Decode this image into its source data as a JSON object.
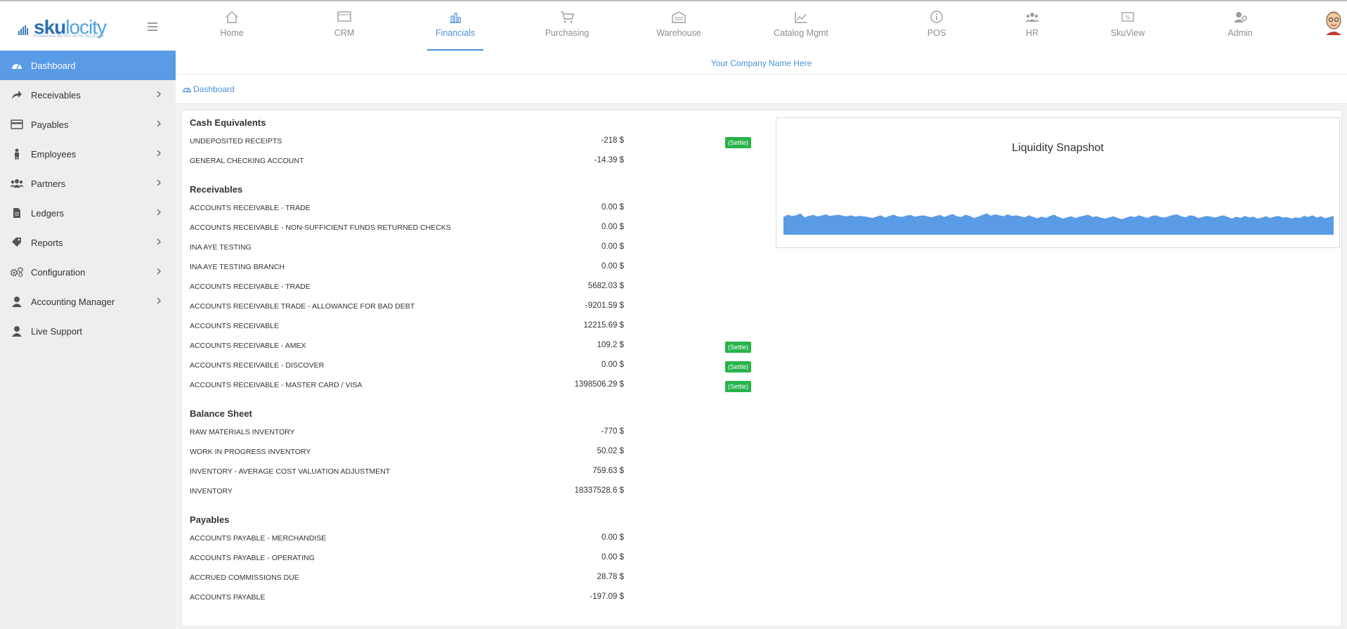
{
  "app": {
    "logo_text_main": "sku",
    "logo_text_accent": "locity",
    "logo_tagline": "POWERING RETAIL WITH VELOCITY"
  },
  "topnav": [
    {
      "label": "Home",
      "icon": "home-icon"
    },
    {
      "label": "CRM",
      "icon": "crm-icon"
    },
    {
      "label": "Financials",
      "icon": "bar-chart-icon",
      "active": true
    },
    {
      "label": "Purchasing",
      "icon": "cart-icon"
    },
    {
      "label": "Warehouse",
      "icon": "warehouse-icon"
    },
    {
      "label": "Catalog Mgmt",
      "icon": "line-chart-icon"
    },
    {
      "label": "POS",
      "icon": "info-icon"
    },
    {
      "label": "HR",
      "icon": "users-icon"
    },
    {
      "label": "SkuView",
      "icon": "money-icon"
    },
    {
      "label": "Admin",
      "icon": "admin-icon"
    }
  ],
  "sidebar": {
    "items": [
      {
        "label": "Dashboard",
        "icon": "dashboard-icon",
        "active": true,
        "has_children": false
      },
      {
        "label": "Receivables",
        "icon": "share-icon",
        "has_children": true
      },
      {
        "label": "Payables",
        "icon": "credit-card-icon",
        "has_children": true
      },
      {
        "label": "Employees",
        "icon": "person-icon",
        "has_children": true
      },
      {
        "label": "Partners",
        "icon": "group-icon",
        "has_children": true
      },
      {
        "label": "Ledgers",
        "icon": "document-icon",
        "has_children": true
      },
      {
        "label": "Reports",
        "icon": "tag-icon",
        "has_children": true
      },
      {
        "label": "Configuration",
        "icon": "gears-icon",
        "has_children": true
      },
      {
        "label": "Accounting Manager",
        "icon": "user-icon",
        "has_children": true
      },
      {
        "label": "Live Support",
        "icon": "user-icon",
        "has_children": false
      }
    ]
  },
  "company_name": "Your Company Name Here",
  "breadcrumb": "Dashboard",
  "settle_label": "(Settle)",
  "sections": [
    {
      "title": "Cash Equivalents",
      "rows": [
        {
          "label": "UNDEPOSITED RECEIPTS",
          "value": "-218 $",
          "settle": true
        },
        {
          "label": "GENERAL CHECKING ACCOUNT",
          "value": "-14.39 $",
          "settle": false
        }
      ]
    },
    {
      "title": "Receivables",
      "rows": [
        {
          "label": "ACCOUNTS RECEIVABLE - TRADE",
          "value": "0.00 $",
          "settle": false
        },
        {
          "label": "ACCOUNTS RECEIVABLE - NON-SUFFICIENT FUNDS RETURNED CHECKS",
          "value": "0.00 $",
          "settle": false
        },
        {
          "label": "INA AYE TESTING",
          "value": "0.00 $",
          "settle": false
        },
        {
          "label": "INA AYE TESTING BRANCH",
          "value": "0.00 $",
          "settle": false
        },
        {
          "label": "ACCOUNTS RECEIVABLE - TRADE",
          "value": "5682.03 $",
          "settle": false
        },
        {
          "label": "ACCOUNTS RECEIVABLE TRADE - ALLOWANCE FOR BAD DEBT",
          "value": "-9201.59 $",
          "settle": false
        },
        {
          "label": "ACCOUNTS RECEIVABLE",
          "value": "12215.69 $",
          "settle": false
        },
        {
          "label": "ACCOUNTS RECEIVABLE - AMEX",
          "value": "109.2 $",
          "settle": true
        },
        {
          "label": "ACCOUNTS RECEIVABLE - DISCOVER",
          "value": "0.00 $",
          "settle": true
        },
        {
          "label": "ACCOUNTS RECEIVABLE - MASTER CARD / VISA",
          "value": "1398506.29 $",
          "settle": true
        }
      ]
    },
    {
      "title": "Balance Sheet",
      "rows": [
        {
          "label": "RAW MATERIALS INVENTORY",
          "value": "-770 $",
          "settle": false
        },
        {
          "label": "WORK IN PROGRESS INVENTORY",
          "value": "50.02 $",
          "settle": false
        },
        {
          "label": "INVENTORY - AVERAGE COST VALUATION ADJUSTMENT",
          "value": "759.63 $",
          "settle": false
        },
        {
          "label": "INVENTORY",
          "value": "18337528.6 $",
          "settle": false
        }
      ]
    },
    {
      "title": "Payables",
      "rows": [
        {
          "label": "ACCOUNTS PAYABLE - MERCHANDISE",
          "value": "0.00 $",
          "settle": false
        },
        {
          "label": "ACCOUNTS PAYABLE - OPERATING",
          "value": "0.00 $",
          "settle": false
        },
        {
          "label": "ACCRUED COMMISSIONS DUE",
          "value": "28.78 $",
          "settle": false
        },
        {
          "label": "ACCOUNTS PAYABLE",
          "value": "-197.09 $",
          "settle": false
        }
      ]
    }
  ],
  "chart_data": {
    "type": "area",
    "title": "Liquidity Snapshot",
    "color": "#5a9be6",
    "ylim": [
      0,
      100
    ],
    "values": [
      55,
      62,
      58,
      60,
      66,
      54,
      58,
      61,
      57,
      59,
      63,
      58,
      60,
      62,
      59,
      57,
      60,
      56,
      58,
      57,
      55,
      52,
      56,
      60,
      53,
      58,
      62,
      57,
      55,
      59,
      61,
      56,
      58,
      60,
      57,
      54,
      58,
      61,
      55,
      60,
      64,
      57,
      55,
      62,
      58,
      52,
      56,
      61,
      66,
      59,
      63,
      60,
      57,
      63,
      58,
      60,
      57,
      54,
      60,
      55,
      51,
      56,
      52,
      58,
      62,
      55,
      50,
      54,
      57,
      52,
      56,
      59,
      62,
      55,
      57,
      53,
      50,
      54,
      57,
      52,
      48,
      53,
      57,
      55,
      60,
      56,
      52,
      58,
      60,
      55,
      53,
      57,
      61,
      63,
      57,
      54,
      60,
      58,
      52,
      55,
      58,
      56,
      53,
      57,
      60,
      55,
      50,
      56,
      52,
      58,
      54,
      56,
      50,
      53,
      57,
      52,
      56,
      58,
      53,
      55,
      50,
      54,
      52,
      58,
      55,
      60,
      53,
      57,
      51,
      55,
      58
    ]
  }
}
